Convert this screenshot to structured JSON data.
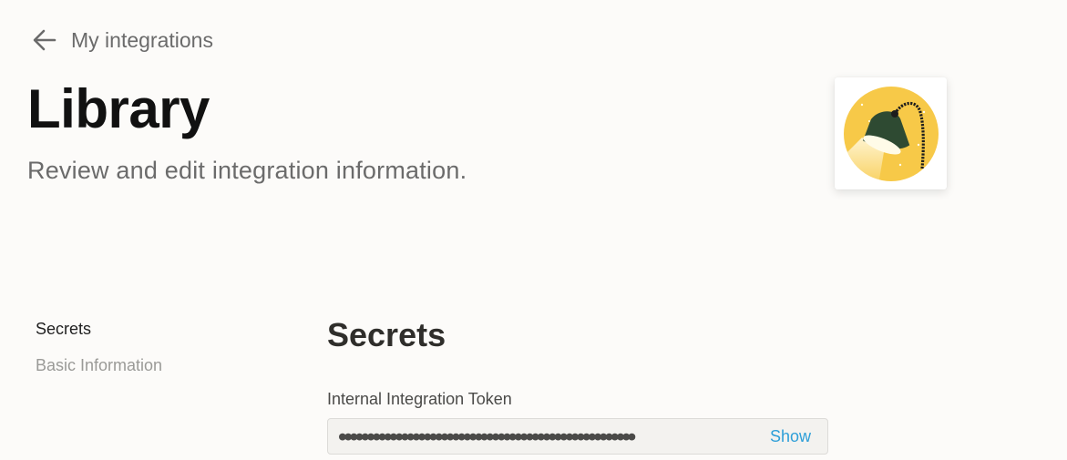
{
  "header": {
    "back_icon": "arrow-left-icon",
    "back_label": "My integrations",
    "title": "Library",
    "subtitle": "Review and edit integration information."
  },
  "logo": {
    "icon": "desk-lamp-icon",
    "background_color": "#f7c948",
    "lamp_color": "#2e4a32"
  },
  "sidebar": {
    "items": [
      {
        "label": "Secrets",
        "active": true
      },
      {
        "label": "Basic Information",
        "active": false
      }
    ]
  },
  "main": {
    "section_title": "Secrets",
    "token": {
      "label": "Internal Integration Token",
      "value": "●●●●●●●●●●●●●●●●●●●●●●●●●●●●●●●●●●●●●●●●●●●●●●●●●●●●",
      "show_label": "Show"
    }
  },
  "colors": {
    "background": "#fcfbf9",
    "link_accent": "#2e9fd8"
  }
}
